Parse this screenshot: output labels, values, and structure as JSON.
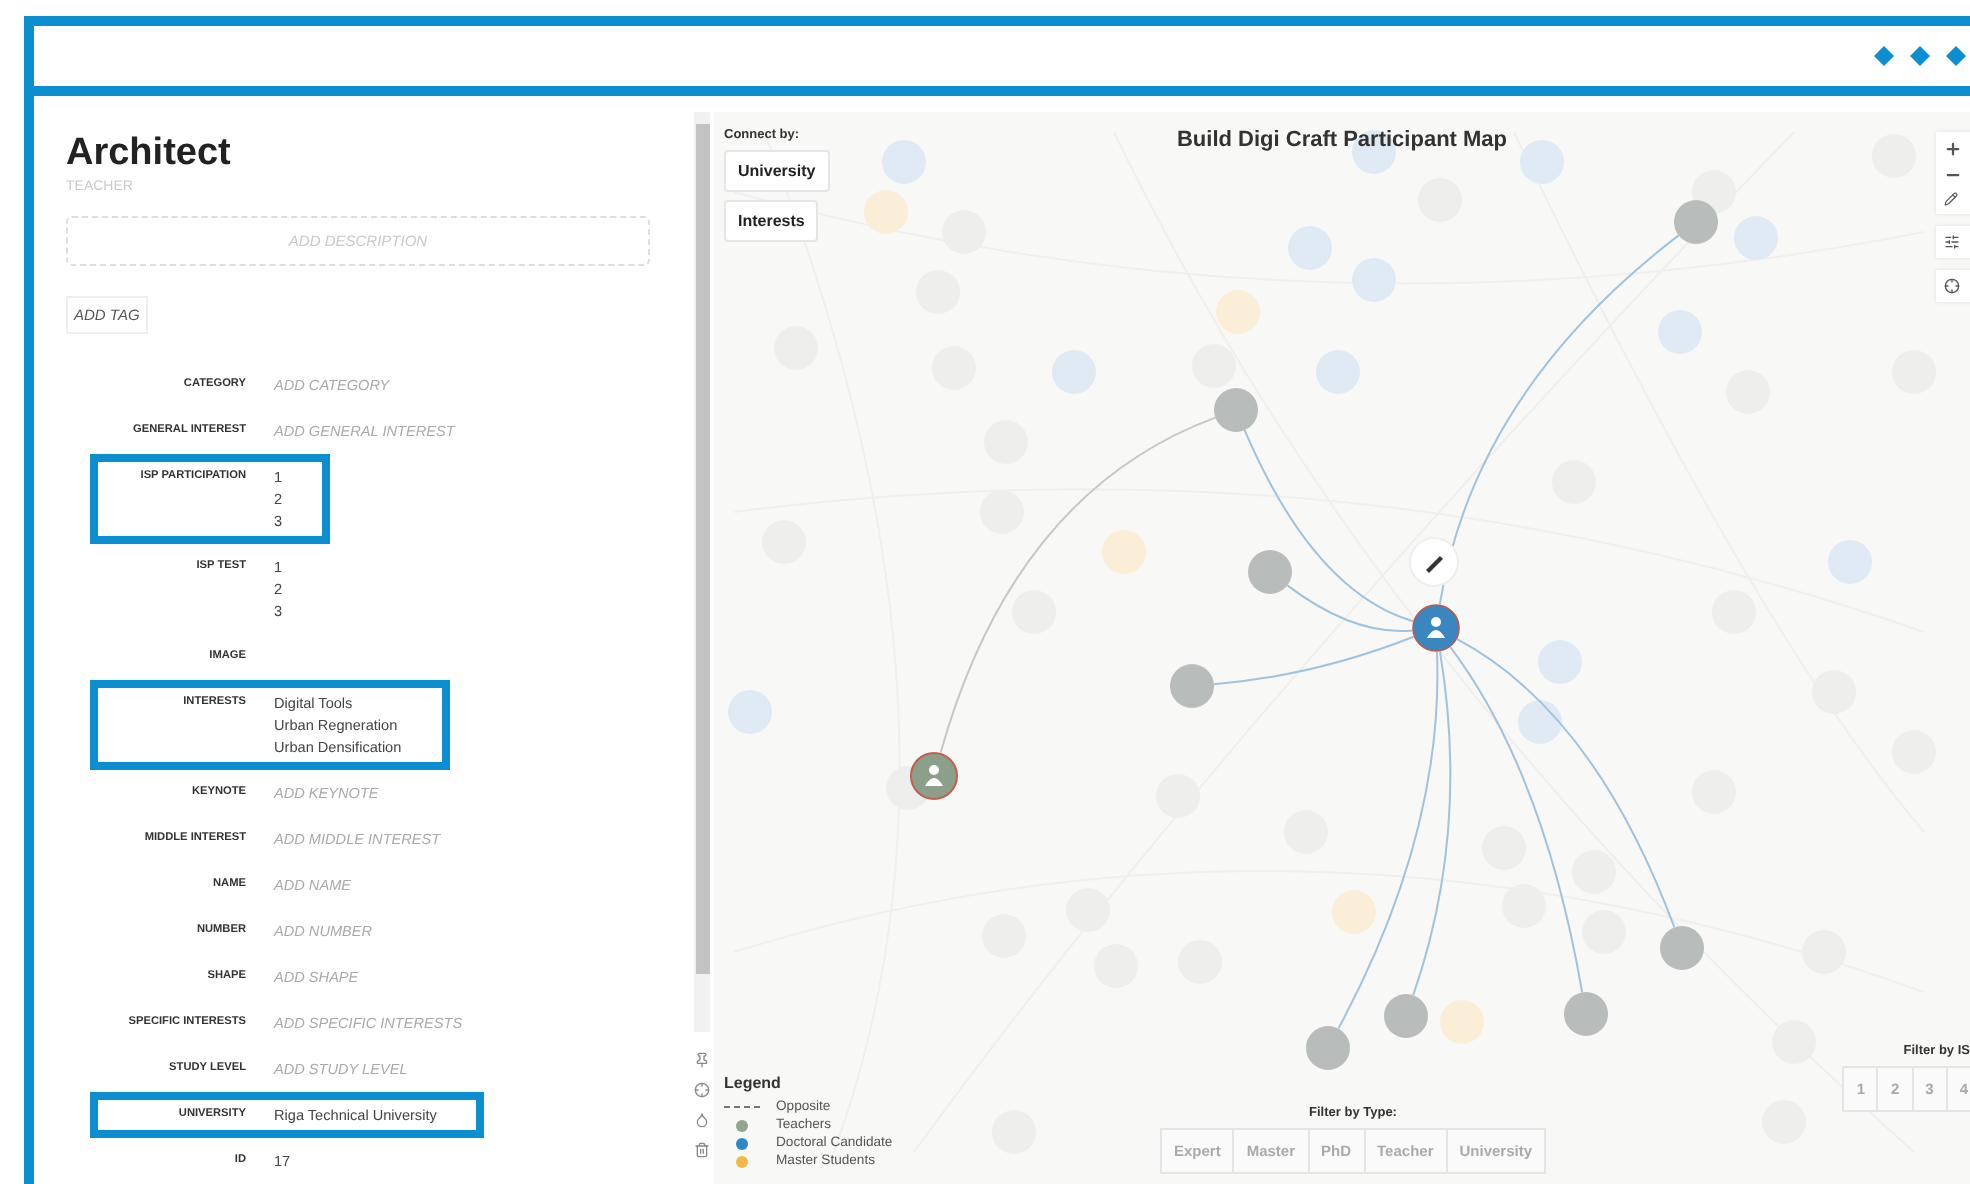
{
  "profile": {
    "title": "Architect",
    "subtitle": "TEACHER",
    "description_placeholder": "ADD DESCRIPTION",
    "add_tag": "ADD TAG"
  },
  "fields": [
    {
      "label": "CATEGORY",
      "placeholder": "ADD CATEGORY",
      "highlighted": false
    },
    {
      "label": "GENERAL INTEREST",
      "placeholder": "ADD GENERAL INTEREST",
      "highlighted": false
    },
    {
      "label": "ISP PARTICIPATION",
      "values": [
        "1",
        "2",
        "3"
      ],
      "highlighted": true
    },
    {
      "label": "ISP TEST",
      "values": [
        "1",
        "2",
        "3"
      ],
      "highlighted": false
    },
    {
      "label": "IMAGE",
      "highlighted": false
    },
    {
      "label": "INTERESTS",
      "values": [
        "Digital Tools",
        "Urban Regneration",
        "Urban Densification"
      ],
      "highlighted": true
    },
    {
      "label": "KEYNOTE",
      "placeholder": "ADD KEYNOTE",
      "highlighted": false
    },
    {
      "label": "MIDDLE INTEREST",
      "placeholder": "ADD MIDDLE INTEREST",
      "highlighted": false
    },
    {
      "label": "NAME",
      "placeholder": "ADD NAME",
      "highlighted": false
    },
    {
      "label": "NUMBER",
      "placeholder": "ADD NUMBER",
      "highlighted": false
    },
    {
      "label": "SHAPE",
      "placeholder": "ADD SHAPE",
      "highlighted": false
    },
    {
      "label": "SPECIFIC INTERESTS",
      "placeholder": "ADD SPECIFIC INTERESTS",
      "highlighted": false
    },
    {
      "label": "STUDY LEVEL",
      "placeholder": "ADD STUDY LEVEL",
      "highlighted": false
    },
    {
      "label": "UNIVERSITY",
      "values": [
        "Riga Technical University"
      ],
      "highlighted": true
    },
    {
      "label": "ID",
      "values": [
        "17"
      ],
      "highlighted": false
    }
  ],
  "map": {
    "title": "Build Digi Craft Participant Map",
    "connect_label": "Connect by:",
    "connect_buttons": [
      "University",
      "Interests"
    ],
    "legend": {
      "title": "Legend",
      "items": [
        {
          "kind": "line",
          "label": "Opposite"
        },
        {
          "kind": "dot",
          "label": "Teachers",
          "color": "#8fa58c"
        },
        {
          "kind": "dot",
          "label": "Doctoral Candidate",
          "color": "#2e86c8"
        },
        {
          "kind": "dot",
          "label": "Master Students",
          "color": "#f4b942"
        }
      ]
    },
    "type_filter": {
      "title": "Filter by Type:",
      "options": [
        {
          "label": "Expert",
          "selected": false
        },
        {
          "label": "Master",
          "selected": false
        },
        {
          "label": "PhD",
          "selected": false
        },
        {
          "label": "Teacher",
          "selected": false
        },
        {
          "label": "University",
          "selected": false
        }
      ]
    },
    "isp_filter": {
      "title": "Filter by IS",
      "options": [
        {
          "label": "1",
          "selected": false
        },
        {
          "label": "2",
          "selected": false
        },
        {
          "label": "3",
          "selected": false
        },
        {
          "label": "4",
          "selected": false
        }
      ]
    }
  }
}
